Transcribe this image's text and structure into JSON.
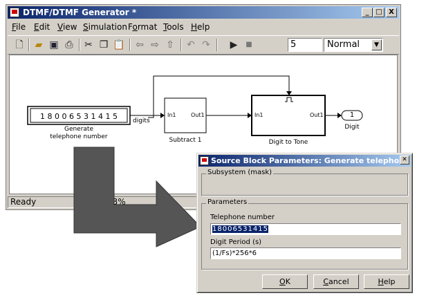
{
  "window": {
    "title": "DTMF/DTMF Generator *",
    "controls": [
      "_",
      "□",
      "X"
    ]
  },
  "menu": [
    {
      "label": "File",
      "u": "F",
      "rest": "ile"
    },
    {
      "label": "Edit",
      "u": "E",
      "rest": "dit"
    },
    {
      "label": "View",
      "u": "V",
      "rest": "iew"
    },
    {
      "label": "Simulation",
      "u": "S",
      "rest": "imulation"
    },
    {
      "label": "Format",
      "u": "o",
      "pre": "F",
      "rest": "rmat"
    },
    {
      "label": "Tools",
      "u": "T",
      "rest": "ools"
    },
    {
      "label": "Help",
      "u": "H",
      "rest": "elp"
    }
  ],
  "toolbar": {
    "icons": [
      "new-icon",
      "open-icon",
      "save-icon",
      "print-icon",
      "cut-icon",
      "copy-icon",
      "paste-icon",
      "back-icon",
      "forward-icon",
      "up-icon",
      "undo-icon",
      "redo-icon",
      "start-icon",
      "stop-icon"
    ],
    "stop_time": "5",
    "sim_mode": "Normal"
  },
  "model": {
    "source_value": "1 8 0 0 6 5 3 1 4 1 5",
    "source_label_1": "Generate",
    "source_label_2": "telephone number",
    "signal_label": "digits",
    "subtract_in": "In1",
    "subtract_out": "Out1",
    "subtract_label": "Subtract 1",
    "tone_in": "In1",
    "tone_out": "Out1",
    "tone_label": "Digit to Tone",
    "outport_number": "1",
    "outport_label": "Digit"
  },
  "status": {
    "ready": "Ready",
    "zoom": "93%"
  },
  "dialog": {
    "title": "Source Block Parameters: Generate telephone number",
    "subsystem_group": "Subsystem (mask)",
    "parameters_group": "Parameters",
    "telephone_label": "Telephone number",
    "telephone_value": "18006531415",
    "period_label": "Digit Period (s)",
    "period_value": "(1/Fs)*256*6",
    "ok": {
      "u": "O",
      "rest": "K"
    },
    "cancel": {
      "u": "C",
      "rest": "ancel"
    },
    "help": {
      "u": "H",
      "rest": "elp"
    }
  },
  "colors": {
    "titlebar_start": "#0a246a",
    "titlebar_end": "#a6caf0",
    "arrow": "#555555",
    "face": "#d4d0c8"
  }
}
